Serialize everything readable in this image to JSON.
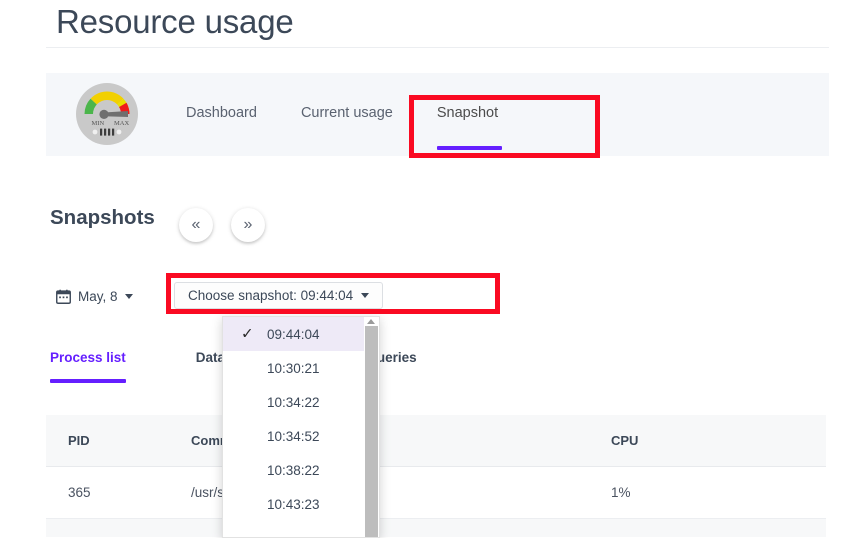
{
  "page": {
    "title": "Resource usage"
  },
  "main_tabs": {
    "icon": "speedometer-gauge-icon",
    "gauge_min_label": "MIN",
    "gauge_max_label": "MAX",
    "items": [
      {
        "label": "Dashboard",
        "active": false
      },
      {
        "label": "Current usage",
        "active": false
      },
      {
        "label": "Snapshot",
        "active": true
      }
    ],
    "active_underline_color": "#651fff"
  },
  "snapshots_section": {
    "heading": "Snapshots",
    "prev_button_label": "«",
    "next_button_label": "»"
  },
  "toolbar": {
    "date_picker": {
      "icon": "calendar-icon",
      "value": "May, 8"
    },
    "snapshot_chooser": {
      "label": "Choose snapshot: 09:44:04",
      "selected_value": "09:44:04",
      "expanded": true
    }
  },
  "snapshot_dropdown": {
    "selected": "09:44:04",
    "check_glyph": "✓",
    "items": [
      {
        "time": "09:44:04",
        "selected": true
      },
      {
        "time": "10:30:21",
        "selected": false
      },
      {
        "time": "10:34:22",
        "selected": false
      },
      {
        "time": "10:34:52",
        "selected": false
      },
      {
        "time": "10:38:22",
        "selected": false
      },
      {
        "time": "10:43:23",
        "selected": false
      }
    ],
    "highlight_color": "#eeeaf7"
  },
  "inner_tabs": {
    "items": [
      {
        "label": "Process list",
        "active": true
      },
      {
        "label": "Databases",
        "active": false
      },
      {
        "label": "Slow queries",
        "active": false
      }
    ]
  },
  "process_table": {
    "columns": [
      "PID",
      "Command",
      "CPU"
    ],
    "rows": [
      {
        "pid": "365",
        "command": "/usr/sbin/httpd -k start",
        "cpu": "1%"
      }
    ]
  },
  "annotations": {
    "color": "#fa0a22",
    "boxes": [
      {
        "name": "snapshot-tab-highlight"
      },
      {
        "name": "choose-snapshot-button-highlight"
      }
    ]
  }
}
